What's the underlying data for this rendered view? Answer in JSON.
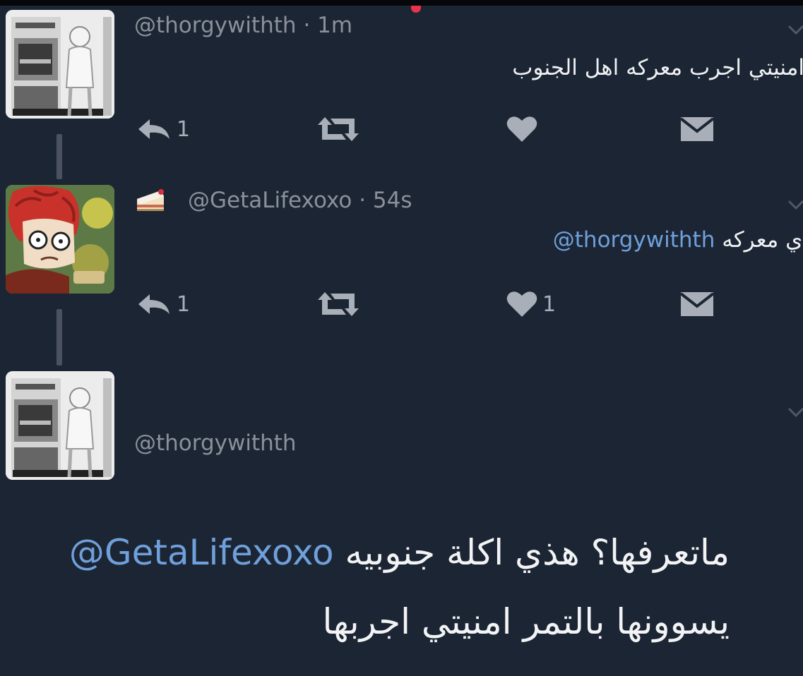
{
  "tweets": [
    {
      "handle": "@thorgywithth",
      "time": "1m",
      "text": "امنيتي اجرب معركه اهل الجنوب",
      "reply_count": "1",
      "like_count": ""
    },
    {
      "handle": "@GetaLifexoxo",
      "time": "54s",
      "mention": "@thorgywithth",
      "text": "اي معركه",
      "reply_count": "1",
      "like_count": "1"
    },
    {
      "handle": "@thorgywithth",
      "mention": "@GetaLifexoxo",
      "text_line1": "ماتعرفها؟ هذي اكلة جنوبيه",
      "text_line2": "يسوونها بالتمر امنيتي اجربها"
    }
  ],
  "separator": "·",
  "icons": {
    "reply": "reply-icon",
    "retweet": "retweet-icon",
    "like": "heart-icon",
    "dm": "envelope-icon",
    "chevron": "chevron-down-icon",
    "badge": "cake-emoji-icon"
  },
  "colors": {
    "background": "#1c2533",
    "mention": "#6fa0db",
    "handle": "#8a919c",
    "text": "#eef0f3",
    "icon": "#a9afb8"
  }
}
